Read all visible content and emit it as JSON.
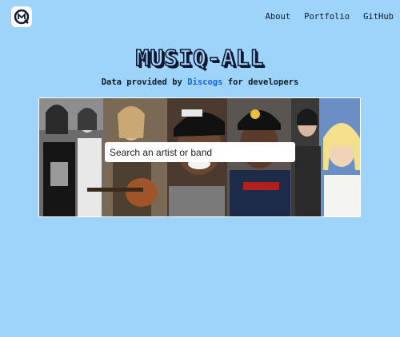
{
  "header": {
    "logo_name": "musiq-all-logo",
    "nav": [
      {
        "label": "About"
      },
      {
        "label": "Portfolio"
      },
      {
        "label": "GitHub"
      }
    ]
  },
  "main": {
    "title": "MUSIQ-ALL",
    "subtitle_prefix": "Data provided by",
    "subtitle_link": "Discogs",
    "subtitle_suffix": "for developers",
    "search_placeholder": "Search an artist or band"
  },
  "colors": {
    "background": "#9fd4fa",
    "link": "#1466d9",
    "title_outline": "#0e1a33"
  }
}
